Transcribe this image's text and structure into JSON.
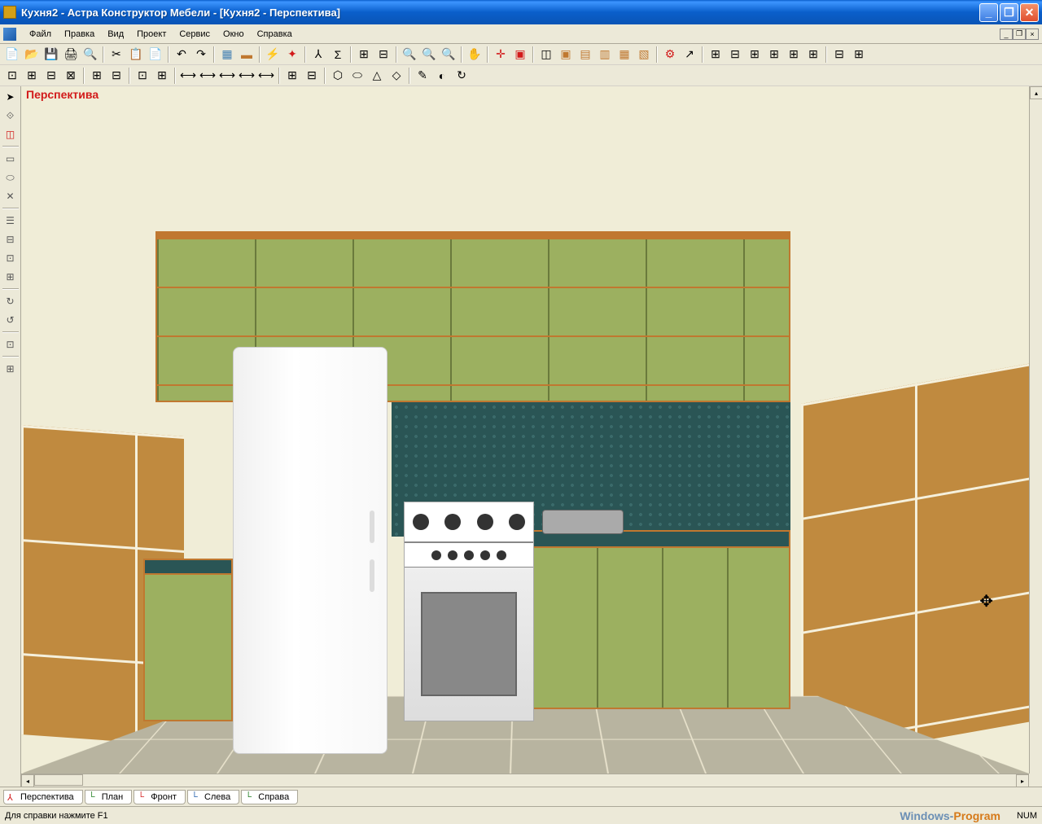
{
  "titlebar": {
    "title": "Кухня2 - Астра Конструктор Мебели - [Кухня2 - Перспектива]"
  },
  "menu": {
    "file": "Файл",
    "edit": "Правка",
    "view": "Вид",
    "project": "Проект",
    "service": "Сервис",
    "window": "Окно",
    "help": "Справка"
  },
  "viewport": {
    "label": "Перспектива"
  },
  "tabs": {
    "perspective": "Перспектива",
    "plan": "План",
    "front": "Фронт",
    "left": "Слева",
    "right": "Справа"
  },
  "statusbar": {
    "help_text": "Для справки нажмите F1",
    "num": "NUM",
    "watermark_1": "Windows-",
    "watermark_2": "Program"
  }
}
